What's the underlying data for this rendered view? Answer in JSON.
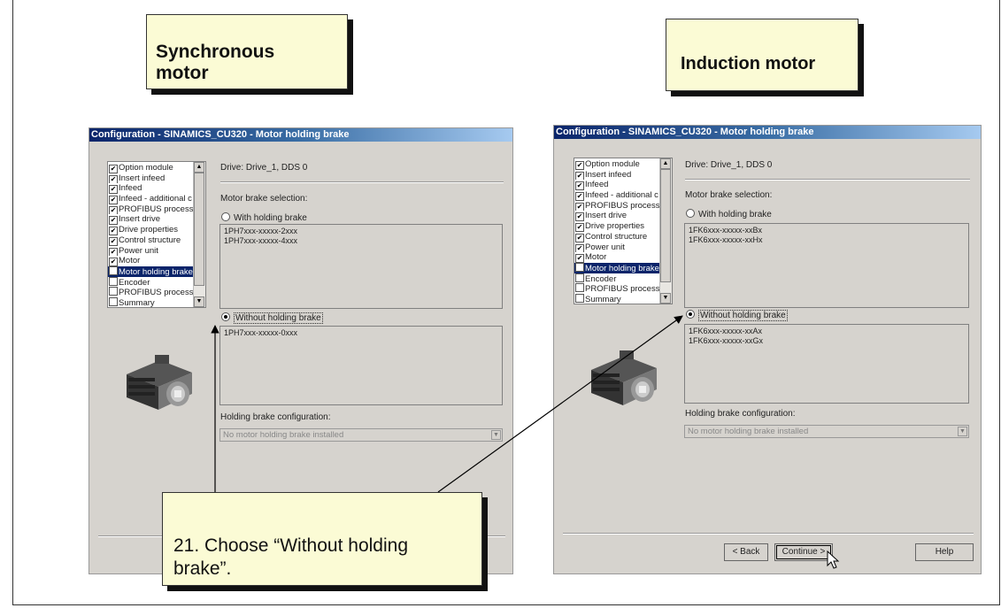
{
  "callouts": {
    "synchronous": "Synchronous motor",
    "induction": "Induction motor",
    "instruction": "21. Choose “Without holding brake”."
  },
  "windows": [
    {
      "title": "Configuration - SINAMICS_CU320 - Motor holding brake",
      "tree_items": [
        {
          "label": "Option module",
          "checked": true,
          "selected": false
        },
        {
          "label": "Insert infeed",
          "checked": true,
          "selected": false
        },
        {
          "label": "Infeed",
          "checked": true,
          "selected": false
        },
        {
          "label": "Infeed - additional c",
          "checked": true,
          "selected": false
        },
        {
          "label": "PROFIBUS process",
          "checked": true,
          "selected": false
        },
        {
          "label": "Insert drive",
          "checked": true,
          "selected": false
        },
        {
          "label": "Drive properties",
          "checked": true,
          "selected": false
        },
        {
          "label": "Control structure",
          "checked": true,
          "selected": false
        },
        {
          "label": "Power unit",
          "checked": true,
          "selected": false
        },
        {
          "label": "Motor",
          "checked": true,
          "selected": false
        },
        {
          "label": "Motor holding brake",
          "checked": false,
          "selected": true
        },
        {
          "label": "Encoder",
          "checked": false,
          "selected": false
        },
        {
          "label": "PROFIBUS process",
          "checked": false,
          "selected": false
        },
        {
          "label": "Summary",
          "checked": false,
          "selected": false
        }
      ],
      "drive": "Drive: Drive_1, DDS 0",
      "brake_selection_label": "Motor brake selection:",
      "with_brake_label": "With holding brake",
      "with_brake_items": [
        "1PH7xxx-xxxxx-2xxx",
        "1PH7xxx-xxxxx-4xxx"
      ],
      "without_brake_label": "Without holding brake",
      "without_brake_items": [
        "1PH7xxx-xxxxx-0xxx"
      ],
      "config_label": "Holding brake configuration:",
      "config_value": "No motor holding brake installed",
      "buttons": {
        "back": "",
        "continue": "",
        "help": ""
      }
    },
    {
      "title": "Configuration - SINAMICS_CU320 - Motor holding brake",
      "tree_items": [
        {
          "label": "Option module",
          "checked": true,
          "selected": false
        },
        {
          "label": "Insert infeed",
          "checked": true,
          "selected": false
        },
        {
          "label": "Infeed",
          "checked": true,
          "selected": false
        },
        {
          "label": "Infeed - additional c",
          "checked": true,
          "selected": false
        },
        {
          "label": "PROFIBUS process",
          "checked": true,
          "selected": false
        },
        {
          "label": "Insert drive",
          "checked": true,
          "selected": false
        },
        {
          "label": "Drive properties",
          "checked": true,
          "selected": false
        },
        {
          "label": "Control structure",
          "checked": true,
          "selected": false
        },
        {
          "label": "Power unit",
          "checked": true,
          "selected": false
        },
        {
          "label": "Motor",
          "checked": true,
          "selected": false
        },
        {
          "label": "Motor holding brake",
          "checked": false,
          "selected": true
        },
        {
          "label": "Encoder",
          "checked": false,
          "selected": false
        },
        {
          "label": "PROFIBUS process",
          "checked": false,
          "selected": false
        },
        {
          "label": "Summary",
          "checked": false,
          "selected": false
        }
      ],
      "drive": "Drive: Drive_1, DDS 0",
      "brake_selection_label": "Motor brake selection:",
      "with_brake_label": "With holding brake",
      "with_brake_items": [
        "1FK6xxx-xxxxx-xxBx",
        "1FK6xxx-xxxxx-xxHx"
      ],
      "without_brake_label": "Without holding brake",
      "without_brake_items": [
        "1FK6xxx-xxxxx-xxAx",
        "1FK6xxx-xxxxx-xxGx"
      ],
      "config_label": "Holding brake configuration:",
      "config_value": "No motor holding brake installed",
      "buttons": {
        "back": "< Back",
        "continue": "Continue >",
        "help": "Help"
      }
    }
  ],
  "colors": {
    "callout_bg": "#fbfbd5",
    "selection": "#0a246a",
    "dialog_bg": "#d6d3ce"
  }
}
